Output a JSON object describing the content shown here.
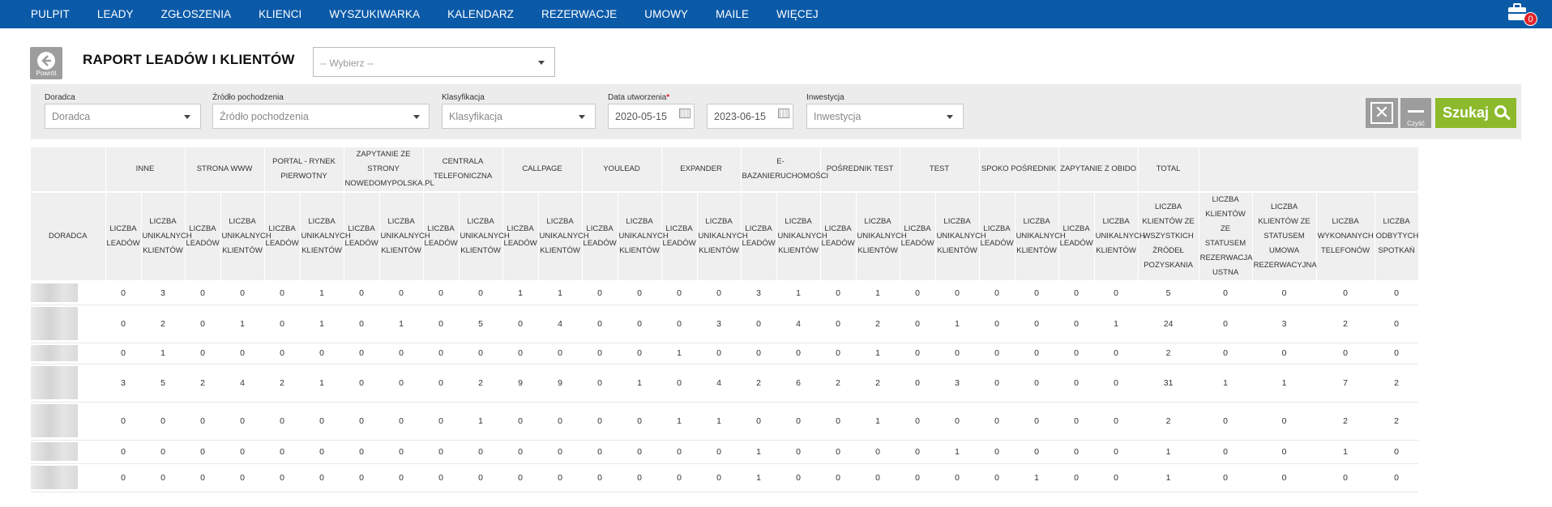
{
  "nav": {
    "items": [
      "PULPIT",
      "LEADY",
      "ZGŁOSZENIA",
      "KLIENCI",
      "WYSZUKIWARKA",
      "KALENDARZ",
      "REZERWACJE",
      "UMOWY",
      "MAILE",
      "WIĘCEJ"
    ],
    "cart_count": "0"
  },
  "header": {
    "back_label": "Powrót",
    "title": "RAPORT LEADÓW I KLIENTÓW",
    "select_placeholder": "-- Wybierz --"
  },
  "filters": {
    "doradca_label": "Doradca",
    "doradca_value": "Doradca",
    "zrodlo_label": "Źródło pochodzenia",
    "zrodlo_value": "Źródło pochodzenia",
    "klasyfikacja_label": "Klasyfikacja",
    "klasyfikacja_value": "Klasyfikacja",
    "data_label": "Data utworzenia",
    "data_required": "*",
    "date_from": "2020-05-15",
    "date_to": "2023-06-15",
    "inwestycja_label": "Inwestycja",
    "inwestycja_value": "Inwestycja",
    "clear_label": "Czyść",
    "search_label": "Szukaj"
  },
  "table": {
    "doradca_header": "DORADCA",
    "groups": [
      "INNE",
      "STRONA WWW",
      "PORTAL - RYNEK PIERWOTNY",
      "ZAPYTANIE ZE STRONY NOWEDOMYPOLSKA.PL",
      "CENTRALA TELEFONICZNA",
      "CALLPAGE",
      "YOULEAD",
      "EXPANDER",
      "E-BAZANIERUCHOMOŚCI",
      "POŚREDNIK TEST",
      "TEST",
      "SPOKO POŚREDNIK",
      "ZAPYTANIE Z OBIDO",
      "TOTAL"
    ],
    "sub_leads": "LICZBA LEADÓW",
    "sub_unique": "LICZBA UNIKALNYCH KLIENTÓW",
    "total_subs": [
      "LICZBA KLIENTÓW ZE WSZYSTKICH ŹRÓDEŁ POZYSKANIA",
      "LICZBA KLIENTÓW ZE STATUSEM REZERWACJA USTNA",
      "LICZBA KLIENTÓW ZE STATUSEM UMOWA REZERWACYJNA",
      "LICZBA WYKONANYCH TELEFONÓW",
      "LICZBA ODBYTYCH SPOTKAŃ"
    ],
    "rows": [
      [
        "0",
        "3",
        "0",
        "0",
        "0",
        "1",
        "0",
        "0",
        "0",
        "0",
        "1",
        "1",
        "0",
        "0",
        "0",
        "0",
        "3",
        "1",
        "0",
        "1",
        "0",
        "0",
        "0",
        "0",
        "0",
        "0",
        "5",
        "0",
        "0",
        "0",
        "0"
      ],
      [
        "0",
        "2",
        "0",
        "1",
        "0",
        "1",
        "0",
        "1",
        "0",
        "5",
        "0",
        "4",
        "0",
        "0",
        "0",
        "3",
        "0",
        "4",
        "0",
        "2",
        "0",
        "1",
        "0",
        "0",
        "0",
        "1",
        "24",
        "0",
        "3",
        "2",
        "0"
      ],
      [
        "0",
        "1",
        "0",
        "0",
        "0",
        "0",
        "0",
        "0",
        "0",
        "0",
        "0",
        "0",
        "0",
        "0",
        "1",
        "0",
        "0",
        "0",
        "0",
        "1",
        "0",
        "0",
        "0",
        "0",
        "0",
        "0",
        "2",
        "0",
        "0",
        "0",
        "0"
      ],
      [
        "3",
        "5",
        "2",
        "4",
        "2",
        "1",
        "0",
        "0",
        "0",
        "2",
        "9",
        "9",
        "0",
        "1",
        "0",
        "4",
        "2",
        "6",
        "2",
        "2",
        "0",
        "3",
        "0",
        "0",
        "0",
        "0",
        "31",
        "1",
        "1",
        "7",
        "2"
      ],
      [
        "0",
        "0",
        "0",
        "0",
        "0",
        "0",
        "0",
        "0",
        "0",
        "1",
        "0",
        "0",
        "0",
        "0",
        "1",
        "1",
        "0",
        "0",
        "0",
        "1",
        "0",
        "0",
        "0",
        "0",
        "0",
        "0",
        "2",
        "0",
        "0",
        "2",
        "2"
      ],
      [
        "0",
        "0",
        "0",
        "0",
        "0",
        "0",
        "0",
        "0",
        "0",
        "0",
        "0",
        "0",
        "0",
        "0",
        "0",
        "0",
        "1",
        "0",
        "0",
        "0",
        "0",
        "1",
        "0",
        "0",
        "0",
        "0",
        "1",
        "0",
        "0",
        "1",
        "0"
      ],
      [
        "0",
        "0",
        "0",
        "0",
        "0",
        "0",
        "0",
        "0",
        "0",
        "0",
        "0",
        "0",
        "0",
        "0",
        "0",
        "0",
        "1",
        "0",
        "0",
        "0",
        "0",
        "0",
        "0",
        "1",
        "0",
        "0",
        "1",
        "0",
        "0",
        "0",
        "0"
      ]
    ]
  },
  "colors": {
    "nav_bg": "#0b5aa8",
    "search_btn": "#8cba2c",
    "required": "#e0242a"
  }
}
